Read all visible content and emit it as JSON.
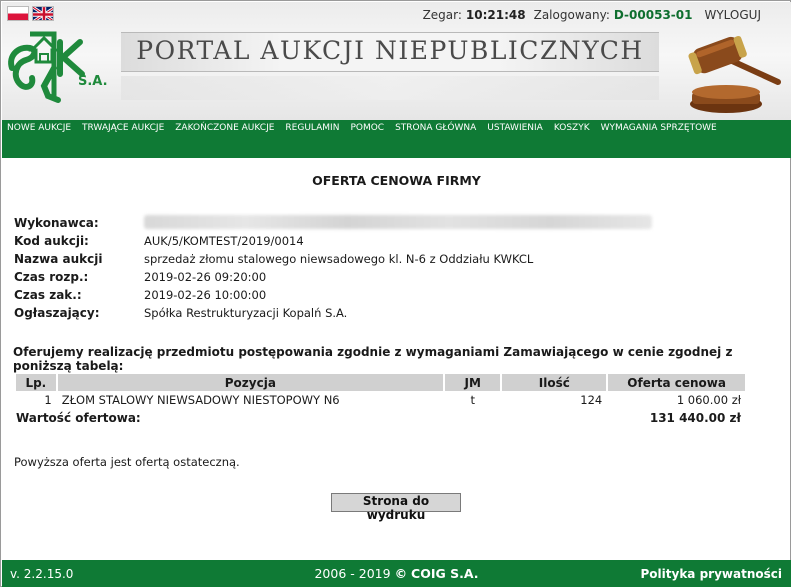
{
  "header": {
    "clock_label": "Zegar:",
    "clock_value": "10:21:48",
    "logged_label": "Zalogowany:",
    "logged_user": "D-00053-01",
    "logout": "WYLOGUJ",
    "banner_title": "PORTAL AUKCJI NIEPUBLICZNYCH",
    "logo_text": "SRK",
    "logo_sub": "S.A."
  },
  "nav": {
    "items": [
      "NOWE AUKCJE",
      "TRWAJĄCE AUKCJE",
      "ZAKOŃCZONE AUKCJE",
      "REGULAMIN",
      "POMOC",
      "STRONA GŁÓWNA",
      "USTAWIENIA",
      "KOSZYK",
      "WYMAGANIA SPRZĘTOWE"
    ]
  },
  "page": {
    "title": "OFERTA CENOWA FIRMY",
    "fields": [
      {
        "label": "Wykonawca:",
        "value": ""
      },
      {
        "label": "Kod aukcji:",
        "value": "AUK/5/KOMTEST/2019/0014"
      },
      {
        "label": "Nazwa aukcji",
        "value": "sprzedaż złomu stalowego niewsadowego kl. N-6 z Oddziału KWKCL"
      },
      {
        "label": "Czas rozp.:",
        "value": "2019-02-26 09:20:00"
      },
      {
        "label": "Czas zak.:",
        "value": "2019-02-26 10:00:00"
      },
      {
        "label": "Ogłaszający:",
        "value": "Spółka Restrukturyzacji Kopalń S.A."
      }
    ],
    "intro": "Oferujemy realizację przedmiotu postępowania zgodnie z wymaganiami Zamawiającego w cenie zgodnej z poniższą tabelą:",
    "table": {
      "headers": [
        "Lp.",
        "Pozycja",
        "JM",
        "Ilość",
        "Oferta cenowa"
      ],
      "rows": [
        [
          "1",
          "ZŁOM STALOWY NIEWSADOWY NIESTOPOWY N6",
          "t",
          "124",
          "1 060.00 zł"
        ]
      ],
      "total_label": "Wartość ofertowa:",
      "total_value": "131 440.00 zł"
    },
    "final_note": "Powyższa oferta jest ofertą ostateczną.",
    "print_button": "Strona do wydruku"
  },
  "footer": {
    "version": "v. 2.2.15.0",
    "copyright_years": "2006 - 2019",
    "copyright_symbol": "©",
    "copyright_owner": "COIG S.A.",
    "privacy": "Polityka prywatności"
  },
  "colors": {
    "brand_green": "#0f7a35",
    "user_green": "#0e6e2e",
    "table_header": "#d0d0d0"
  }
}
